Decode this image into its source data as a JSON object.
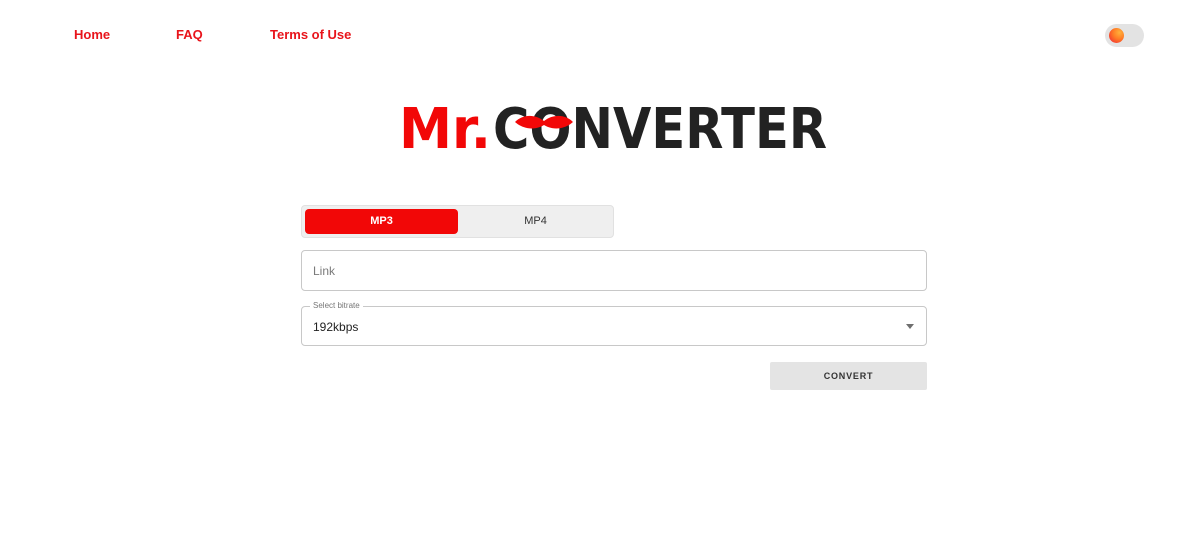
{
  "nav": {
    "home": "Home",
    "faq": "FAQ",
    "terms": "Terms of Use"
  },
  "logo": {
    "prefix": "Mr.",
    "name": "CONVERTER"
  },
  "tabs": [
    {
      "label": "MP3",
      "active": true
    },
    {
      "label": "MP4",
      "active": false
    }
  ],
  "link_input": {
    "value": "",
    "placeholder": "Link"
  },
  "bitrate": {
    "legend": "Select bitrate",
    "selected": "192kbps"
  },
  "convert_label": "CONVERT",
  "colors": {
    "accent": "#f20707",
    "nav_link": "#e8141b",
    "logo_dark": "#222222"
  }
}
